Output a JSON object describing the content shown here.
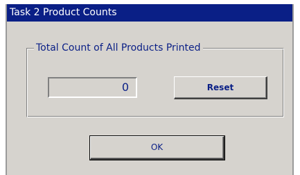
{
  "window": {
    "title": "Task 2 Product Counts"
  },
  "group": {
    "label": "Total Count of All Products Printed",
    "count_value": "0",
    "reset_label": "Reset"
  },
  "buttons": {
    "ok_label": "OK"
  },
  "colors": {
    "title_bar": "#0a1f86",
    "dialog_background": "#d6d3ce",
    "text": "#0a1f86"
  }
}
